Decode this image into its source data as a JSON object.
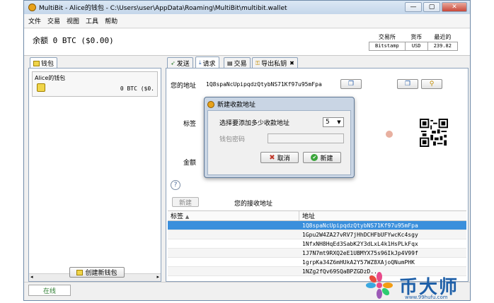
{
  "window": {
    "title": "MultiBit - Alice的钱包 - C:\\Users\\user\\AppData\\Roaming\\MultiBit\\multibit.wallet",
    "controls": [
      "—",
      "▢",
      "✕"
    ]
  },
  "menu": [
    "文件",
    "交易",
    "视图",
    "工具",
    "帮助"
  ],
  "balance": {
    "text": "余额 0 BTC ($0.00)"
  },
  "rates": {
    "headers": [
      "交易所",
      "货币",
      "最近的"
    ],
    "values": [
      "Bitstamp",
      "USD",
      "239.82"
    ]
  },
  "wallets_tab": "钱包",
  "wallet": {
    "name": "Alice的钱包",
    "balance": "0 BTC  ($0."
  },
  "create_wallet": "创建新钱包",
  "tabs": [
    "发送",
    "请求",
    "交易",
    "导出私钥"
  ],
  "request": {
    "your_address_label": "您的地址",
    "address": "1Q8spaNcUpipqdzQtybNS71Kf97u95mFpa",
    "label_label": "标签",
    "amount_label": "金额",
    "new_button": "新建",
    "receiving_title": "您的接收地址",
    "columns": [
      "标签",
      "地址"
    ],
    "addresses": [
      "1Q8spaNcUpipqdzQtybNS71Kf97u95mFpa",
      "1Gpu2W4ZA27vRV7jHhDCHFbUFYwcKc4sgy",
      "1NfxNH8HqEd3SabK2Y3dLxL4k1HsPLkFqx",
      "1J7N7mt9RXQ2eE1UBMYX75s96IkJp4V99f",
      "1grpKa34Z6mHUkA2Y57WZ8XAjoQNumPHK",
      "1NZg2fQv69SQaBPZGDzD..."
    ]
  },
  "status": "在线",
  "dialog": {
    "title": "新建收款地址",
    "count_label": "选择要添加多少收款地址",
    "count_value": "5",
    "password_label": "钱包密码",
    "cancel": "取消",
    "create": "新建"
  },
  "watermark": {
    "text": "币大师",
    "url": "www.99hufu.com"
  }
}
